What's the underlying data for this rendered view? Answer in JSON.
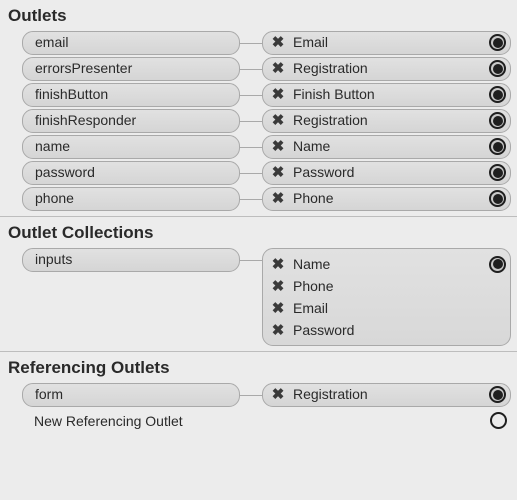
{
  "sections": {
    "outlets": {
      "title": "Outlets",
      "rows": [
        {
          "name": "email",
          "target": "Email",
          "filled": true
        },
        {
          "name": "errorsPresenter",
          "target": "Registration",
          "filled": true
        },
        {
          "name": "finishButton",
          "target": "Finish Button",
          "filled": true
        },
        {
          "name": "finishResponder",
          "target": "Registration",
          "filled": true
        },
        {
          "name": "name",
          "target": "Name",
          "filled": true
        },
        {
          "name": "password",
          "target": "Password",
          "filled": true
        },
        {
          "name": "phone",
          "target": "Phone",
          "filled": true
        }
      ]
    },
    "outletCollections": {
      "title": "Outlet Collections",
      "rows": [
        {
          "name": "inputs",
          "targets": [
            "Name",
            "Phone",
            "Email",
            "Password"
          ],
          "filled": true
        }
      ]
    },
    "referencingOutlets": {
      "title": "Referencing Outlets",
      "rows": [
        {
          "name": "form",
          "target": "Registration",
          "filled": true
        }
      ],
      "newRowLabel": "New Referencing Outlet"
    }
  }
}
